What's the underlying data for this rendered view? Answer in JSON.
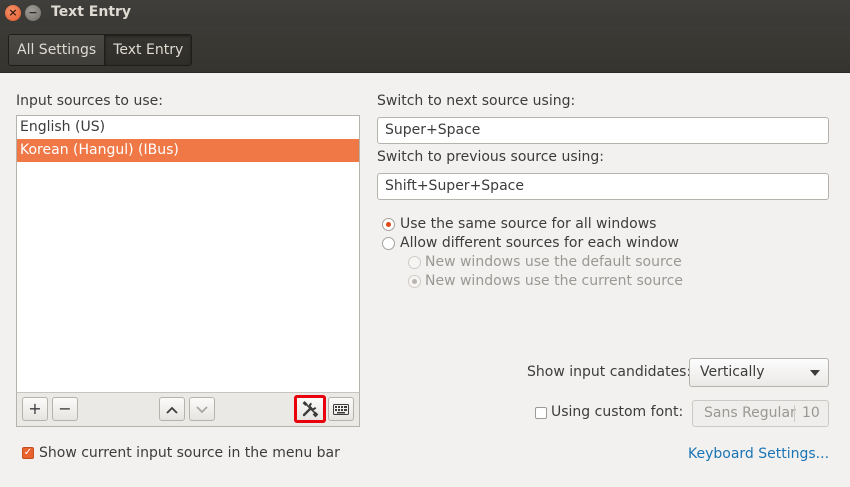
{
  "window": {
    "title": "Text Entry"
  },
  "breadcrumbs": [
    "All Settings",
    "Text Entry"
  ],
  "sources": {
    "label": "Input sources to use:",
    "items": [
      "English (US)",
      "Korean (Hangul) (IBus)"
    ],
    "selected_index": 1,
    "toolbar": {
      "add": "+",
      "remove": "−",
      "up": "⌃",
      "down": "⌄",
      "settings_icon": "preferences-tools-icon",
      "keyboard_icon": "keyboard-icon"
    }
  },
  "switch_next": {
    "label": "Switch to next source using:",
    "value": "Super+Space"
  },
  "switch_prev": {
    "label": "Switch to previous source using:",
    "value": "Shift+Super+Space"
  },
  "window_mode": {
    "same": "Use the same source for all windows",
    "different": "Allow different sources for each window",
    "default_src": "New windows use the default source",
    "current_src": "New windows use the current source",
    "selected": "same"
  },
  "candidates": {
    "label": "Show input candidates:",
    "value": "Vertically"
  },
  "custom_font": {
    "label": "Using custom font:",
    "checked": false,
    "font": "Sans Regular",
    "size": "10"
  },
  "show_menu": {
    "label": "Show current input source in the menu bar",
    "checked": true
  },
  "keyboard_link": "Keyboard Settings...",
  "colors": {
    "accent": "#f07746",
    "link": "#1b74b4",
    "highlight_box": "#e8000c"
  }
}
